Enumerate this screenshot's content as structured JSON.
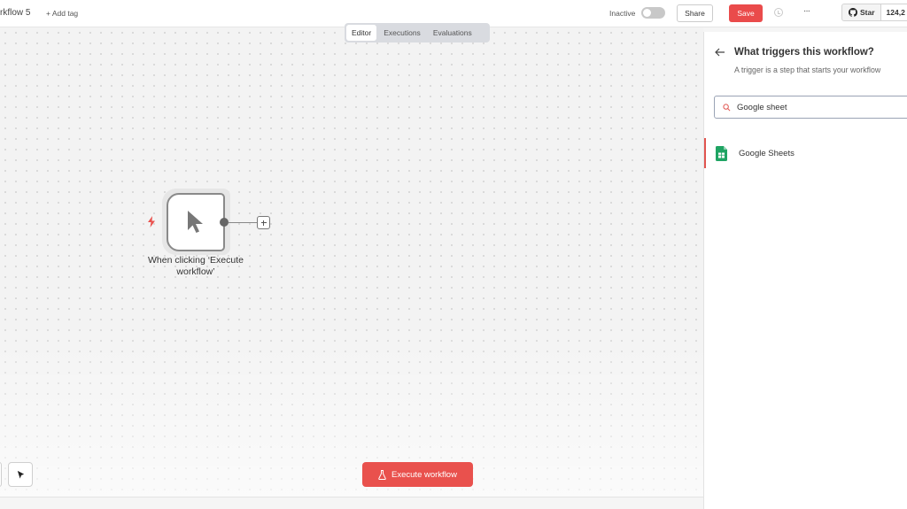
{
  "header": {
    "workflow_title": "rkflow 5",
    "add_tag": "+ Add tag",
    "status_label": "Inactive",
    "share_label": "Share",
    "save_label": "Save",
    "more_label": "···",
    "github_star_label": "Star",
    "github_star_count": "124,2",
    "accent_color": "#ea4b4b"
  },
  "tabs": [
    {
      "label": "Editor",
      "active": true
    },
    {
      "label": "Executions",
      "active": false
    },
    {
      "label": "Evaluations",
      "active": false
    }
  ],
  "canvas": {
    "node": {
      "label": "When clicking ‘Execute workflow’",
      "icon": "cursor-pointer-icon"
    },
    "execute_button_label": "Execute workflow"
  },
  "panel": {
    "title": "What triggers this workflow?",
    "subtitle": "A trigger is a step that starts your workflow",
    "search_value": "Google sheet",
    "results": [
      {
        "label": "Google Sheets",
        "icon": "google-sheets-icon"
      }
    ]
  }
}
